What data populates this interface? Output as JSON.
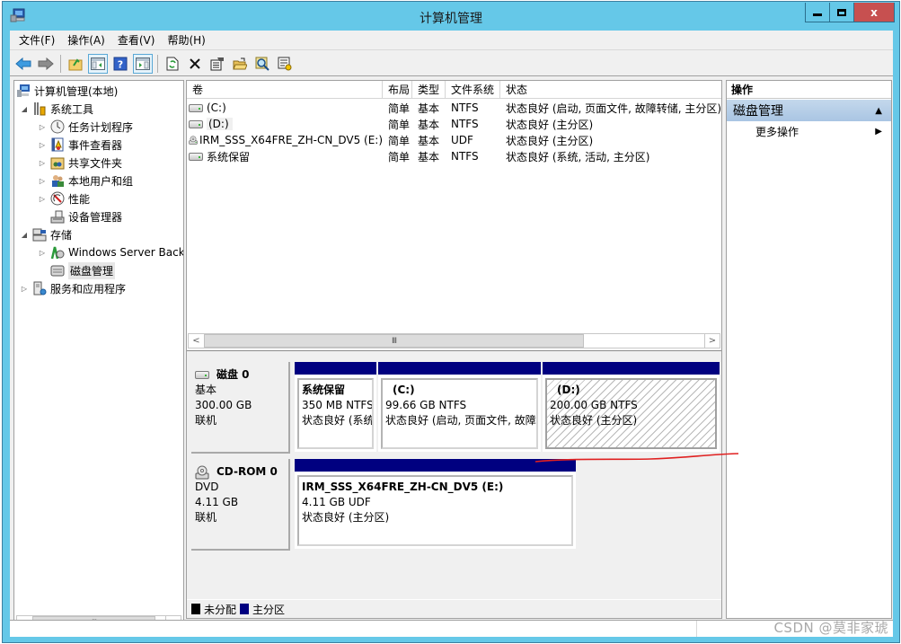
{
  "window": {
    "title": "计算机管理",
    "controls": {
      "minimize": "minimize",
      "maximize": "maximize",
      "close": "x"
    }
  },
  "menu": {
    "items": [
      "文件(F)",
      "操作(A)",
      "查看(V)",
      "帮助(H)"
    ]
  },
  "toolbar": {
    "buttons": [
      "back-arrow",
      "forward-arrow",
      "up-folder",
      "show-hide-console-tree",
      "help",
      "show-hide-action-pane",
      "refresh",
      "delete",
      "properties",
      "open",
      "search",
      "settings"
    ]
  },
  "tree": {
    "items": [
      {
        "label": "计算机管理(本地)",
        "level": 0,
        "expander": "",
        "icon": "computer-management-icon"
      },
      {
        "label": "系统工具",
        "level": 1,
        "expander": "expanded",
        "icon": "system-tools-icon"
      },
      {
        "label": "任务计划程序",
        "level": 2,
        "expander": "collapsed",
        "icon": "clock-icon"
      },
      {
        "label": "事件查看器",
        "level": 2,
        "expander": "collapsed",
        "icon": "event-viewer-icon"
      },
      {
        "label": "共享文件夹",
        "level": 2,
        "expander": "collapsed",
        "icon": "shared-folder-icon"
      },
      {
        "label": "本地用户和组",
        "level": 2,
        "expander": "collapsed",
        "icon": "users-icon"
      },
      {
        "label": "性能",
        "level": 2,
        "expander": "collapsed",
        "icon": "performance-icon"
      },
      {
        "label": "设备管理器",
        "level": 2,
        "expander": "",
        "icon": "device-manager-icon"
      },
      {
        "label": "存储",
        "level": 1,
        "expander": "expanded",
        "icon": "storage-icon"
      },
      {
        "label": "Windows Server Back",
        "level": 2,
        "expander": "collapsed",
        "icon": "backup-icon"
      },
      {
        "label": "磁盘管理",
        "level": 2,
        "expander": "",
        "icon": "disk-management-icon",
        "selected": true
      },
      {
        "label": "服务和应用程序",
        "level": 1,
        "expander": "collapsed",
        "icon": "services-icon"
      }
    ],
    "scroll_thumb": "III"
  },
  "volumes": {
    "columns": [
      "卷",
      "布局",
      "类型",
      "文件系统",
      "状态"
    ],
    "rows": [
      {
        "name": "(C:)",
        "layout": "简单",
        "type": "基本",
        "fs": "NTFS",
        "status": "状态良好 (启动, 页面文件, 故障转储, 主分区)",
        "icon": "drive"
      },
      {
        "name": "(D:)",
        "layout": "简单",
        "type": "基本",
        "fs": "NTFS",
        "status": "状态良好 (主分区)",
        "icon": "drive"
      },
      {
        "name": "IRM_SSS_X64FRE_ZH-CN_DV5 (E:)",
        "layout": "简单",
        "type": "基本",
        "fs": "UDF",
        "status": "状态良好 (主分区)",
        "icon": "cd"
      },
      {
        "name": "系统保留",
        "layout": "简单",
        "type": "基本",
        "fs": "NTFS",
        "status": "状态良好 (系统, 活动, 主分区)",
        "icon": "drive"
      }
    ],
    "scroll_thumb": "III"
  },
  "disks": [
    {
      "title": "磁盘 0",
      "kind": "基本",
      "size": "300.00 GB",
      "state": "联机",
      "partitions": [
        {
          "name": "系统保留",
          "size_fs": "350 MB NTFS",
          "status": "状态良好 (系统, 活动, 主分区)",
          "hatched": false
        },
        {
          "name": "(C:)",
          "size_fs": "99.66 GB NTFS",
          "status": "状态良好 (启动, 页面文件, 故障转储, 主分区)",
          "hatched": false
        },
        {
          "name": "(D:)",
          "size_fs": "200.00 GB NTFS",
          "status": "状态良好 (主分区)",
          "hatched": true
        }
      ]
    },
    {
      "title": "CD-ROM 0",
      "kind": "DVD",
      "size": "4.11 GB",
      "state": "联机",
      "partitions": [
        {
          "name": "IRM_SSS_X64FRE_ZH-CN_DV5  (E:)",
          "size_fs": "4.11 GB UDF",
          "status": "状态良好 (主分区)",
          "hatched": false
        }
      ]
    }
  ],
  "legend": {
    "items": [
      {
        "label": "未分配",
        "color": "#000000"
      },
      {
        "label": "主分区",
        "color": "#000080"
      }
    ]
  },
  "actions": {
    "title": "操作",
    "group": "磁盘管理",
    "items": [
      "更多操作"
    ]
  },
  "colors": {
    "title_bar": "#65c8e8",
    "close_button": "#c75050",
    "partition_bar": "#000080",
    "annotation": "#e02020"
  },
  "watermark": "CSDN @莫非家琥"
}
